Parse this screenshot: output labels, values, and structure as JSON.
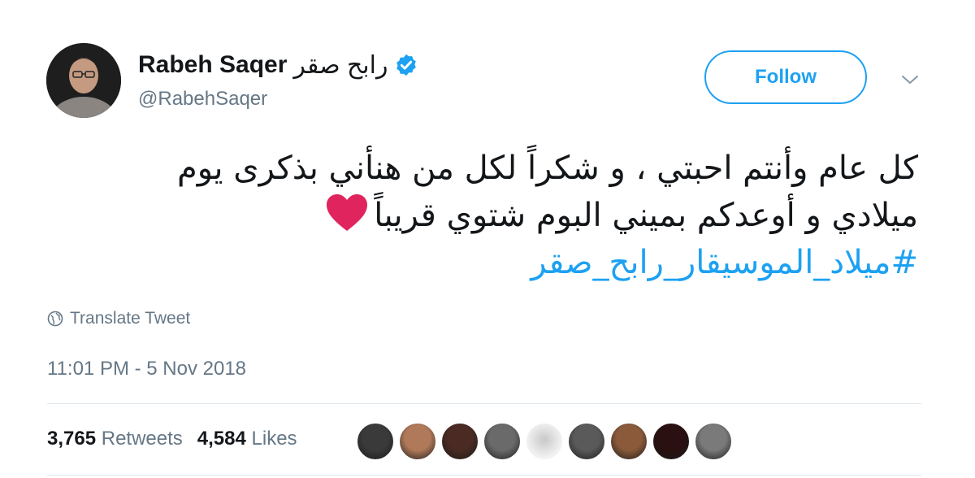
{
  "user": {
    "display_name": "Rabeh Saqer",
    "display_name_arabic": "رابح صقر",
    "handle": "@RabehSaqer",
    "verified": true,
    "avatar_icon": "profile-photo"
  },
  "follow_button": {
    "label": "Follow"
  },
  "menu": {
    "icon": "chevron-down-icon"
  },
  "tweet": {
    "line1": "كل عام وأنتم احبتي ، و شكراً لكل من هنأني بذكرى يوم",
    "line2": "ميلادي و أوعدكم بميني البوم شتوي قريباً",
    "hashtag": "#ميلاد_الموسيقار_رابح_صقر",
    "heart_icon": "red-heart-emoji"
  },
  "translate": {
    "label": "Translate Tweet",
    "icon": "globe-icon"
  },
  "timestamp": "11:01 PM - 5 Nov 2018",
  "stats": {
    "retweets_count": "3,765",
    "retweets_label": "Retweets",
    "likes_count": "4,584",
    "likes_label": "Likes"
  },
  "likers": [
    {
      "avatar": "liker-1",
      "color": "#3a3a3a"
    },
    {
      "avatar": "liker-2",
      "color": "#b07a5a"
    },
    {
      "avatar": "liker-3",
      "color": "#4a2a22"
    },
    {
      "avatar": "liker-4",
      "color": "#6a6a6a"
    },
    {
      "avatar": "liker-5",
      "color": "#d8d8d8"
    },
    {
      "avatar": "liker-6",
      "color": "#5a5a5a"
    },
    {
      "avatar": "liker-7",
      "color": "#8a5a3a"
    },
    {
      "avatar": "liker-8",
      "color": "#2a1010"
    },
    {
      "avatar": "liker-9",
      "color": "#7a7a7a"
    }
  ],
  "colors": {
    "accent": "#1da1f2",
    "muted": "#657786",
    "heart": "#e0245e"
  }
}
